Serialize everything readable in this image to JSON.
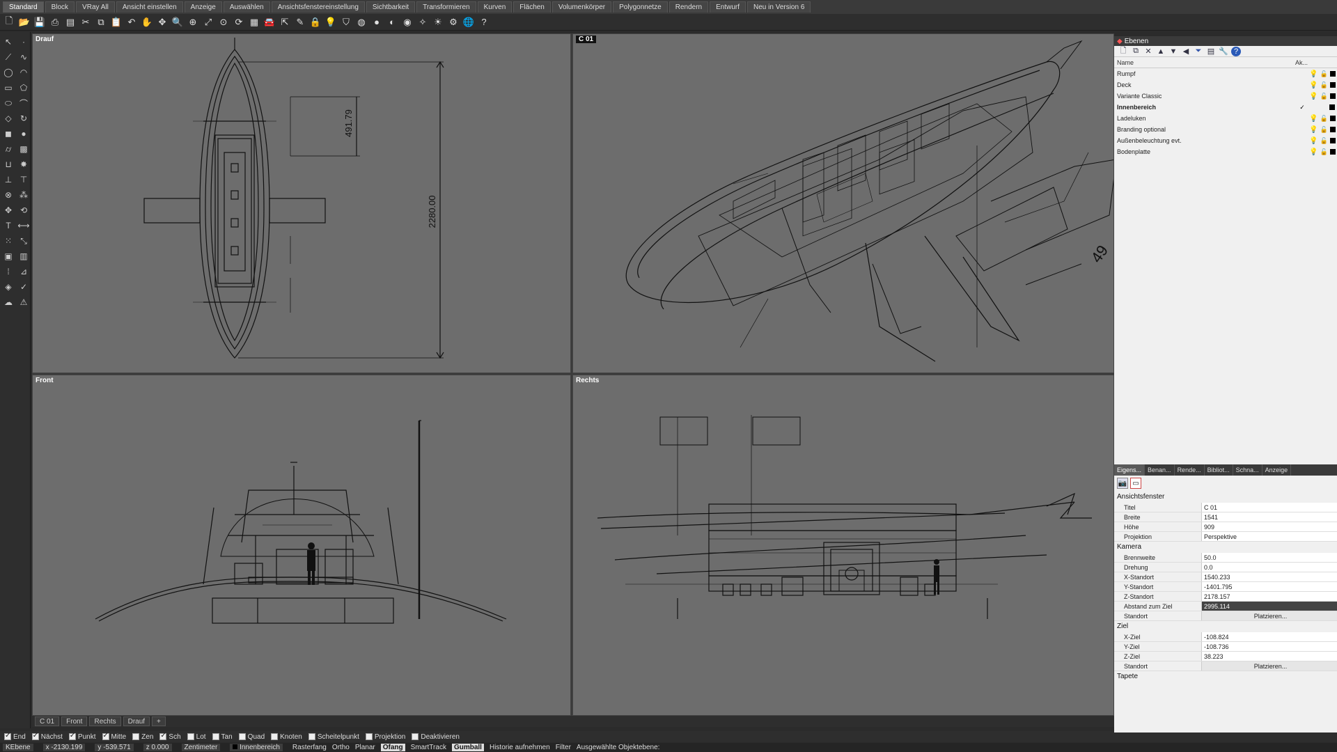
{
  "tabs": [
    "Standard",
    "Block",
    "VRay All",
    "Ansicht einstellen",
    "Anzeige",
    "Auswählen",
    "Ansichtsfenstereinstellung",
    "Sichtbarkeit",
    "Transformieren",
    "Kurven",
    "Flächen",
    "Volumenkörper",
    "Polygonnetze",
    "Rendern",
    "Entwurf",
    "Neu in Version 6"
  ],
  "viewports": {
    "top_left": {
      "title": "Drauf",
      "dimension_width": "491.79",
      "dimension_length": "2280.00"
    },
    "top_right": {
      "title": "C 01",
      "dimension": "49"
    },
    "bottom_left": {
      "title": "Front"
    },
    "bottom_right": {
      "title": "Rechts"
    }
  },
  "viewport_tabs": [
    "C 01",
    "Front",
    "Rechts",
    "Drauf",
    "+"
  ],
  "osnaps": [
    {
      "label": "End",
      "checked": true
    },
    {
      "label": "Nächst",
      "checked": true
    },
    {
      "label": "Punkt",
      "checked": true
    },
    {
      "label": "Mitte",
      "checked": true
    },
    {
      "label": "Zen",
      "checked": false
    },
    {
      "label": "Sch",
      "checked": true
    },
    {
      "label": "Lot",
      "checked": false
    },
    {
      "label": "Tan",
      "checked": false
    },
    {
      "label": "Quad",
      "checked": false
    },
    {
      "label": "Knoten",
      "checked": false
    },
    {
      "label": "Scheitelpunkt",
      "checked": false
    },
    {
      "label": "Projektion",
      "checked": false
    },
    {
      "label": "Deaktivieren",
      "checked": false
    }
  ],
  "status": {
    "layer_label": "KEbene",
    "x": "x -2130.199",
    "y": "y -539.571",
    "z": "z 0.000",
    "unit": "Zentimeter",
    "current_layer": "Innenbereich",
    "modes": [
      "Rasterfang",
      "Ortho",
      "Planar",
      "Ofang",
      "SmartTrack",
      "Gumball",
      "Historie aufnehmen",
      "Filter"
    ],
    "modes_on": [
      "Ofang",
      "Gumball"
    ],
    "message": "Ausgewählte Objektebene:"
  },
  "layers_panel": {
    "title": "Ebenen",
    "col_name": "Name",
    "col_active": "Ak...",
    "layers": [
      {
        "name": "Rumpf",
        "current": false,
        "bulb": "yellow"
      },
      {
        "name": "Deck",
        "current": false,
        "bulb": "yellow"
      },
      {
        "name": "Variante Classic",
        "current": false,
        "bulb": "yellow"
      },
      {
        "name": "Innenbereich",
        "current": true,
        "bulb": "none"
      },
      {
        "name": "Ladeluken",
        "current": false,
        "bulb": "yellow"
      },
      {
        "name": "Branding optional",
        "current": false,
        "bulb": "yellow"
      },
      {
        "name": "Außenbeleuchtung evt.",
        "current": false,
        "bulb": "blue"
      },
      {
        "name": "Bodenplatte",
        "current": false,
        "bulb": "blue"
      }
    ],
    "current_mark": "✓"
  },
  "props_tabs": [
    "Eigens...",
    "Benan...",
    "Rende...",
    "Bibliot...",
    "Schna...",
    "Anzeige"
  ],
  "properties": {
    "section_viewport": "Ansichtsfenster",
    "viewport": [
      {
        "key": "Titel",
        "value": "C 01"
      },
      {
        "key": "Breite",
        "value": "1541"
      },
      {
        "key": "Höhe",
        "value": "909"
      },
      {
        "key": "Projektion",
        "value": "Perspektive"
      }
    ],
    "section_camera": "Kamera",
    "camera": [
      {
        "key": "Brennweite",
        "value": "50.0"
      },
      {
        "key": "Drehung",
        "value": "0.0"
      },
      {
        "key": "X-Standort",
        "value": "1540.233"
      },
      {
        "key": "Y-Standort",
        "value": "-1401.795"
      },
      {
        "key": "Z-Standort",
        "value": "2178.157"
      },
      {
        "key": "Abstand zum Ziel",
        "value": "2995.114"
      },
      {
        "key": "Standort",
        "value": "Platzieren..."
      }
    ],
    "section_target": "Ziel",
    "target": [
      {
        "key": "X-Ziel",
        "value": "-108.824"
      },
      {
        "key": "Y-Ziel",
        "value": "-108.736"
      },
      {
        "key": "Z-Ziel",
        "value": "38.223"
      },
      {
        "key": "Standort",
        "value": "Platzieren..."
      }
    ],
    "section_wallpaper": "Tapete"
  }
}
